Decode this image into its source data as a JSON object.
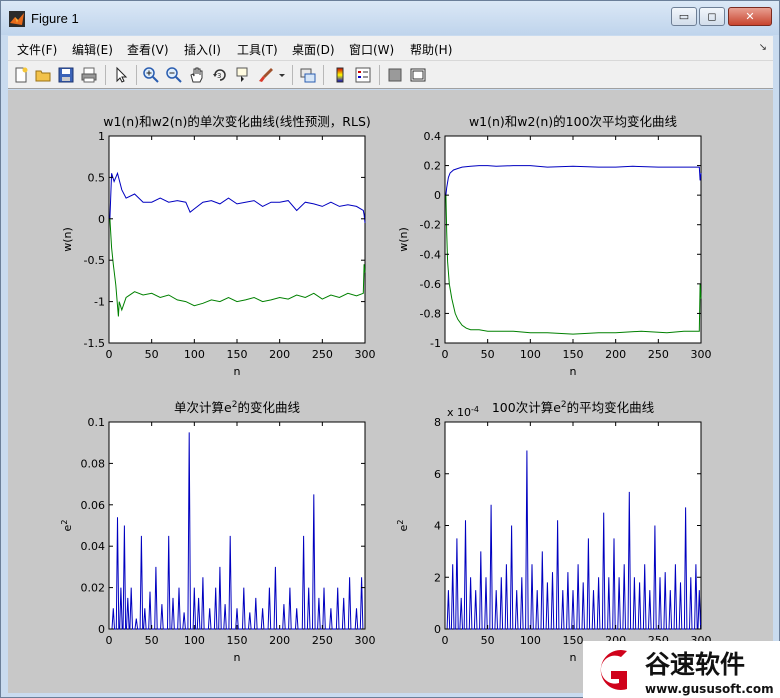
{
  "window": {
    "title": "Figure 1"
  },
  "title_buttons": {
    "minimize": "▭",
    "maximize": "◻",
    "close": "✕"
  },
  "menu": [
    "文件(F)",
    "编辑(E)",
    "查看(V)",
    "插入(I)",
    "工具(T)",
    "桌面(D)",
    "窗口(W)",
    "帮助(H)"
  ],
  "menu_arrow": "↘",
  "toolbar": [
    "new-figure-icon",
    "open-icon",
    "save-icon",
    "print-icon",
    "select-arrow-icon",
    "zoom-in-icon",
    "zoom-out-icon",
    "pan-icon",
    "rotate-3d-icon",
    "data-cursor-icon",
    "brush-icon",
    "dropdown-arrow-icon",
    "link-plot-icon",
    "colorbar-icon",
    "legend-icon",
    "hide-plot-tools-icon",
    "show-plot-tools-icon"
  ],
  "colors": {
    "figure_bg": "#c8c8c8",
    "series_1": "#0000c0",
    "series_2": "#008000"
  },
  "chart_data": [
    {
      "type": "line",
      "title": "w1(n)和w2(n)的单次变化曲线(线性预测，RLS)",
      "xlabel": "n",
      "ylabel": "w(n)",
      "xlim": [
        0,
        300
      ],
      "ylim": [
        -1.5,
        1
      ],
      "xticks": [
        "0",
        "50",
        "100",
        "150",
        "200",
        "250",
        "300"
      ],
      "yticks": [
        "-1.5",
        "-1",
        "-0.5",
        "0",
        "0.5",
        "1"
      ],
      "series": [
        {
          "x": [
            1,
            3,
            6,
            10,
            15,
            20,
            30,
            40,
            50,
            60,
            70,
            80,
            90,
            95,
            100,
            110,
            120,
            130,
            140,
            150,
            160,
            170,
            180,
            190,
            200,
            210,
            220,
            230,
            240,
            250,
            260,
            270,
            280,
            290,
            298,
            299,
            300
          ],
          "values": [
            0,
            0.55,
            0.45,
            0.55,
            0.35,
            0.25,
            0.3,
            0.2,
            0.2,
            0.25,
            0.2,
            0.22,
            0.2,
            0.08,
            0.12,
            0.2,
            0.22,
            0.18,
            0.25,
            0.18,
            0.2,
            0.22,
            0.15,
            0.2,
            0.2,
            0.22,
            0.1,
            0.2,
            0.18,
            0.15,
            0.2,
            0.15,
            0.17,
            0.15,
            0.1,
            0.05,
            -0.05
          ]
        },
        {
          "x": [
            1,
            3,
            5,
            8,
            10,
            11,
            12,
            15,
            20,
            30,
            40,
            50,
            60,
            70,
            80,
            90,
            100,
            110,
            120,
            130,
            140,
            150,
            160,
            170,
            180,
            190,
            200,
            210,
            220,
            230,
            240,
            250,
            260,
            270,
            280,
            290,
            298,
            299,
            300
          ],
          "values": [
            0,
            -0.35,
            -0.55,
            -0.8,
            -1.05,
            -1.18,
            -1.0,
            -1.1,
            -0.95,
            -0.88,
            -0.92,
            -0.9,
            -0.95,
            -0.92,
            -0.98,
            -1.0,
            -1.05,
            -1.02,
            -0.98,
            -1.0,
            -0.95,
            -1.0,
            -0.98,
            -0.95,
            -1.0,
            -0.98,
            -0.95,
            -0.97,
            -0.92,
            -0.95,
            -0.9,
            -0.97,
            -0.92,
            -0.95,
            -0.9,
            -0.93,
            -0.9,
            -0.55,
            -0.65
          ]
        }
      ]
    },
    {
      "type": "line",
      "title": "w1(n)和w2(n)的100次平均变化曲线",
      "xlabel": "n",
      "ylabel": "w(n)",
      "xlim": [
        0,
        300
      ],
      "ylim": [
        -1,
        0.4
      ],
      "xticks": [
        "0",
        "50",
        "100",
        "150",
        "200",
        "250",
        "300"
      ],
      "yticks": [
        "-1",
        "-0.8",
        "-0.6",
        "-0.4",
        "-0.2",
        "0",
        "0.2",
        "0.4"
      ],
      "series": [
        {
          "x": [
            1,
            2,
            4,
            6,
            10,
            15,
            20,
            30,
            40,
            50,
            60,
            80,
            100,
            120,
            150,
            180,
            200,
            220,
            250,
            280,
            298,
            299,
            300
          ],
          "values": [
            0,
            0.05,
            0.12,
            0.15,
            0.17,
            0.18,
            0.19,
            0.195,
            0.2,
            0.2,
            0.195,
            0.2,
            0.2,
            0.19,
            0.195,
            0.19,
            0.19,
            0.195,
            0.19,
            0.19,
            0.19,
            0.1,
            0.15
          ]
        },
        {
          "x": [
            1,
            2,
            3,
            5,
            8,
            10,
            12,
            15,
            20,
            25,
            30,
            40,
            50,
            60,
            80,
            100,
            120,
            150,
            180,
            200,
            230,
            260,
            280,
            298,
            299,
            300
          ],
          "values": [
            0,
            -0.25,
            -0.45,
            -0.6,
            -0.7,
            -0.75,
            -0.8,
            -0.84,
            -0.88,
            -0.9,
            -0.91,
            -0.91,
            -0.92,
            -0.92,
            -0.92,
            -0.93,
            -0.93,
            -0.94,
            -0.93,
            -0.93,
            -0.92,
            -0.93,
            -0.92,
            -0.92,
            -0.6,
            -0.7
          ]
        }
      ]
    },
    {
      "type": "line",
      "title": "单次计算e²的变化曲线",
      "xlabel": "n",
      "ylabel": "e²",
      "xlim": [
        0,
        300
      ],
      "ylim": [
        0,
        0.1
      ],
      "xticks": [
        "0",
        "50",
        "100",
        "150",
        "200",
        "250",
        "300"
      ],
      "yticks": [
        "0",
        "0.02",
        "0.04",
        "0.06",
        "0.08",
        "0.1"
      ],
      "spikes": [
        [
          5,
          0.01
        ],
        [
          10,
          0.054
        ],
        [
          14,
          0.02
        ],
        [
          18,
          0.05
        ],
        [
          22,
          0.015
        ],
        [
          26,
          0.02
        ],
        [
          32,
          0.005
        ],
        [
          38,
          0.045
        ],
        [
          42,
          0.01
        ],
        [
          48,
          0.018
        ],
        [
          55,
          0.03
        ],
        [
          62,
          0.012
        ],
        [
          70,
          0.045
        ],
        [
          75,
          0.015
        ],
        [
          82,
          0.02
        ],
        [
          88,
          0.008
        ],
        [
          94,
          0.095
        ],
        [
          100,
          0.02
        ],
        [
          105,
          0.015
        ],
        [
          110,
          0.025
        ],
        [
          118,
          0.01
        ],
        [
          125,
          0.02
        ],
        [
          130,
          0.03
        ],
        [
          136,
          0.012
        ],
        [
          142,
          0.045
        ],
        [
          150,
          0.01
        ],
        [
          158,
          0.02
        ],
        [
          165,
          0.008
        ],
        [
          172,
          0.015
        ],
        [
          180,
          0.01
        ],
        [
          188,
          0.02
        ],
        [
          195,
          0.03
        ],
        [
          205,
          0.012
        ],
        [
          212,
          0.02
        ],
        [
          220,
          0.01
        ],
        [
          228,
          0.045
        ],
        [
          234,
          0.02
        ],
        [
          240,
          0.065
        ],
        [
          246,
          0.015
        ],
        [
          252,
          0.02
        ],
        [
          260,
          0.01
        ],
        [
          268,
          0.02
        ],
        [
          275,
          0.015
        ],
        [
          282,
          0.025
        ],
        [
          290,
          0.01
        ],
        [
          296,
          0.025
        ]
      ]
    },
    {
      "type": "line",
      "title": "100次计算e²的平均变化曲线",
      "xlabel": "n",
      "ylabel": "e²",
      "scale_label": "x 10",
      "scale_exponent": "-4",
      "xlim": [
        0,
        300
      ],
      "ylim": [
        0,
        8
      ],
      "xticks": [
        "0",
        "50",
        "100",
        "150",
        "200",
        "250",
        "300"
      ],
      "yticks": [
        "0",
        "2",
        "4",
        "6",
        "8"
      ],
      "spikes": [
        [
          4,
          1.5
        ],
        [
          9,
          2.5
        ],
        [
          14,
          3.5
        ],
        [
          19,
          1.2
        ],
        [
          24,
          4.2
        ],
        [
          30,
          2
        ],
        [
          36,
          1.5
        ],
        [
          42,
          3
        ],
        [
          48,
          2
        ],
        [
          54,
          4.8
        ],
        [
          60,
          1.5
        ],
        [
          66,
          2
        ],
        [
          72,
          2.5
        ],
        [
          78,
          4
        ],
        [
          84,
          1.5
        ],
        [
          90,
          2
        ],
        [
          96,
          6.9
        ],
        [
          102,
          2.5
        ],
        [
          108,
          1.5
        ],
        [
          114,
          3
        ],
        [
          120,
          1.8
        ],
        [
          126,
          2.2
        ],
        [
          132,
          4.2
        ],
        [
          138,
          1.5
        ],
        [
          144,
          2.2
        ],
        [
          150,
          1.5
        ],
        [
          156,
          2.5
        ],
        [
          162,
          1.8
        ],
        [
          168,
          3.5
        ],
        [
          174,
          1.5
        ],
        [
          180,
          2
        ],
        [
          186,
          4.5
        ],
        [
          192,
          2
        ],
        [
          198,
          3.5
        ],
        [
          204,
          2
        ],
        [
          210,
          2.5
        ],
        [
          216,
          5.3
        ],
        [
          222,
          2
        ],
        [
          228,
          1.8
        ],
        [
          234,
          2.5
        ],
        [
          240,
          1.5
        ],
        [
          246,
          4
        ],
        [
          252,
          2
        ],
        [
          258,
          2.2
        ],
        [
          264,
          1.5
        ],
        [
          270,
          2.5
        ],
        [
          276,
          1.8
        ],
        [
          282,
          4.7
        ],
        [
          288,
          2
        ],
        [
          294,
          2.5
        ],
        [
          298,
          1.5
        ]
      ]
    }
  ],
  "watermark": {
    "brand": "谷速软件",
    "url": "www.gususoft.com"
  }
}
